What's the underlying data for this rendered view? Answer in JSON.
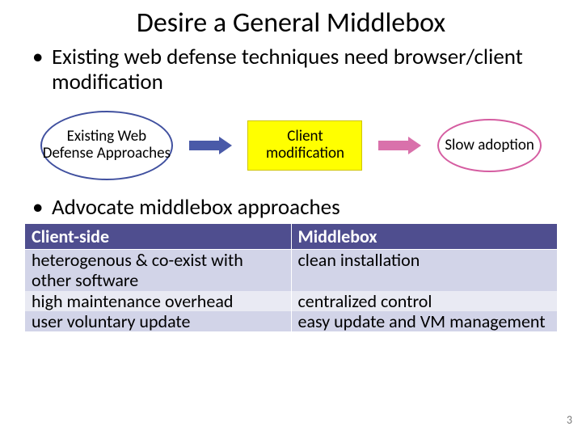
{
  "title": "Desire a General Middlebox",
  "bullet1": "Existing web defense techniques need browser/client modification",
  "flow": {
    "node1": "Existing Web Defense Approaches",
    "node2": "Client modification",
    "node3": "Slow adoption"
  },
  "bullet2": "Advocate middlebox approaches",
  "table": {
    "headers": {
      "col1": "Client-side",
      "col2": "Middlebox"
    },
    "rows": [
      {
        "c1": "heterogenous & co-exist with other software",
        "c2": "clean installation"
      },
      {
        "c1": "high maintenance overhead",
        "c2": "centralized control"
      },
      {
        "c1": "user voluntary update",
        "c2": "easy update and VM management"
      }
    ]
  },
  "page_number": "3"
}
